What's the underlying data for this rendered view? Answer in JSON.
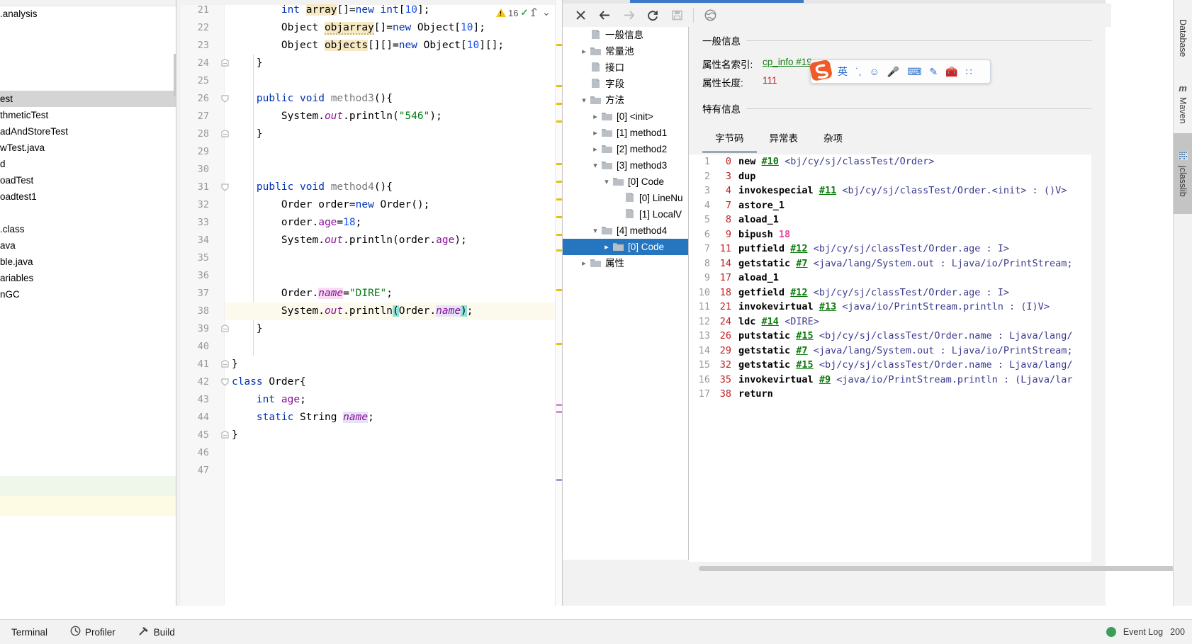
{
  "project_tree": {
    "name": "project-file-tree",
    "items": [
      {
        "label": ".analysis",
        "selected": false
      },
      {
        "label": "",
        "selected": false
      },
      {
        "label": "",
        "selected": false
      },
      {
        "label": "",
        "selected": false
      },
      {
        "label": "",
        "selected": false
      },
      {
        "label": "est",
        "selected": true
      },
      {
        "label": "thmeticTest",
        "selected": false
      },
      {
        "label": "adAndStoreTest",
        "selected": false
      },
      {
        "label": "wTest.java",
        "selected": false
      },
      {
        "label": "d",
        "selected": false
      },
      {
        "label": "oadTest",
        "selected": false
      },
      {
        "label": "oadtest1",
        "selected": false
      },
      {
        "label": "",
        "selected": false
      },
      {
        "label": ".class",
        "selected": false
      },
      {
        "label": "ava",
        "selected": false
      },
      {
        "label": "ble.java",
        "selected": false
      },
      {
        "label": "ariables",
        "selected": false
      },
      {
        "label": "nGC",
        "selected": false
      }
    ]
  },
  "editor": {
    "name": "code-editor",
    "current_line": 38,
    "inspection": {
      "warning_count": "16",
      "check_count": "1",
      "up_label": "⌃",
      "down_label": "⌄"
    },
    "lines": [
      {
        "n": "21",
        "html": "        <span class='kw'>int</span> <span class='hl-ident'>array</span>[]=<span class='kw'>new</span> <span class='kw'>int</span>[<span class='num'>10</span>];"
      },
      {
        "n": "22",
        "html": "        Object <span class='hl-ident squiggle'>objarray</span>[]=<span class='kw'>new</span> Object[<span class='num'>10</span>];"
      },
      {
        "n": "23",
        "html": "        Object <span class='hl-ident'>objects</span>[][]=<span class='kw'>new</span> Object[<span class='num'>10</span>][];"
      },
      {
        "n": "24",
        "html": "    }"
      },
      {
        "n": "25",
        "html": ""
      },
      {
        "n": "26",
        "html": "    <span class='kw'>public</span> <span class='kw'>void</span> <span class='mname'>method3</span>(){"
      },
      {
        "n": "27",
        "html": "        System.<span class='fld-i'>out</span>.println(<span class='str'>\"546\"</span>);"
      },
      {
        "n": "28",
        "html": "    }"
      },
      {
        "n": "29",
        "html": ""
      },
      {
        "n": "30",
        "html": ""
      },
      {
        "n": "31",
        "html": "    <span class='kw'>public</span> <span class='kw'>void</span> <span class='mname'>method4</span>(){"
      },
      {
        "n": "32",
        "html": "        Order order=<span class='kw'>new</span> Order();"
      },
      {
        "n": "33",
        "html": "        order.<span class='fld'>age</span>=<span class='num'>18</span>;"
      },
      {
        "n": "34",
        "html": "        System.<span class='fld-i'>out</span>.println(order.<span class='fld'>age</span>);"
      },
      {
        "n": "35",
        "html": ""
      },
      {
        "n": "36",
        "html": ""
      },
      {
        "n": "37",
        "html": "        Order.<span class='fld-i hl-pink'>name</span>=<span class='str'>\"DIRE\"</span>;"
      },
      {
        "n": "38",
        "html": "        System.<span class='fld-i'>out</span>.println<span class='hl-teal'>(</span>Order.<span class='fld-i hl-lav'>name</span><span class='hl-teal'>)</span>;"
      },
      {
        "n": "39",
        "html": "    }"
      },
      {
        "n": "40",
        "html": ""
      },
      {
        "n": "41",
        "html": "}"
      },
      {
        "n": "42",
        "html": "<span class='kw'>class</span> Order{"
      },
      {
        "n": "43",
        "html": "    <span class='kw'>int</span> <span class='fld'>age</span>;"
      },
      {
        "n": "44",
        "html": "    <span class='kw'>static</span> String <span class='fld-i hl-lav'>name</span>;"
      },
      {
        "n": "45",
        "html": "}"
      },
      {
        "n": "46",
        "html": ""
      },
      {
        "n": "47",
        "html": ""
      }
    ]
  },
  "jclasslib": {
    "toolbar": [
      {
        "name": "close-icon",
        "title": "✕",
        "enabled": true
      },
      {
        "name": "back-arrow-icon",
        "title": "←",
        "enabled": true
      },
      {
        "name": "forward-arrow-icon",
        "title": "→",
        "enabled": false
      },
      {
        "name": "refresh-icon",
        "title": "↻",
        "enabled": true
      },
      {
        "name": "save-icon",
        "title": "Ὃe",
        "enabled": false
      },
      {
        "name": "globe-icon",
        "title": "ἱ0",
        "enabled": true
      }
    ],
    "tree": [
      {
        "label": "一般信息",
        "indent": 1,
        "arrow": "",
        "icon": "file",
        "selected": false
      },
      {
        "label": "常量池",
        "indent": 1,
        "arrow": "collapsed",
        "icon": "folder",
        "selected": false
      },
      {
        "label": "接口",
        "indent": 1,
        "arrow": "",
        "icon": "file",
        "selected": false
      },
      {
        "label": "字段",
        "indent": 1,
        "arrow": "",
        "icon": "file",
        "selected": false
      },
      {
        "label": "方法",
        "indent": 1,
        "arrow": "expanded",
        "icon": "folder",
        "selected": false
      },
      {
        "label": "[0] <init>",
        "indent": 2,
        "arrow": "collapsed",
        "icon": "folder",
        "selected": false
      },
      {
        "label": "[1] method1",
        "indent": 2,
        "arrow": "collapsed",
        "icon": "folder",
        "selected": false
      },
      {
        "label": "[2] method2",
        "indent": 2,
        "arrow": "collapsed",
        "icon": "folder",
        "selected": false
      },
      {
        "label": "[3] method3",
        "indent": 2,
        "arrow": "expanded",
        "icon": "folder",
        "selected": false
      },
      {
        "label": "[0] Code",
        "indent": 3,
        "arrow": "expanded",
        "icon": "folder",
        "selected": false
      },
      {
        "label": "[0] LineNu",
        "indent": 4,
        "arrow": "",
        "icon": "file",
        "selected": false
      },
      {
        "label": "[1] LocalV",
        "indent": 4,
        "arrow": "",
        "icon": "file",
        "selected": false
      },
      {
        "label": "[4] method4",
        "indent": 2,
        "arrow": "expanded",
        "icon": "folder",
        "selected": false
      },
      {
        "label": "[0] Code",
        "indent": 3,
        "arrow": "collapsed",
        "icon": "folder",
        "selected": true
      },
      {
        "label": "属性",
        "indent": 1,
        "arrow": "collapsed",
        "icon": "folder",
        "selected": false
      }
    ],
    "detail": {
      "general_header": "一般信息",
      "attr_name_label": "属性名索引:",
      "attr_name_value": "cp_info #19",
      "attr_len_label": "属性长度:",
      "attr_len_value": "111",
      "specific_header": "特有信息",
      "tabs": [
        {
          "label": "字节码",
          "active": true
        },
        {
          "label": "异常表",
          "active": false
        },
        {
          "label": "杂项",
          "active": false
        }
      ]
    },
    "bytecode": [
      {
        "i": "1",
        "off": "0",
        "op": "new",
        "cp": "#10",
        "arg": "",
        "desc": "<bj/cy/sj/classTest/Order>"
      },
      {
        "i": "2",
        "off": "3",
        "op": "dup",
        "cp": "",
        "arg": "",
        "desc": ""
      },
      {
        "i": "3",
        "off": "4",
        "op": "invokespecial",
        "cp": "#11",
        "arg": "",
        "desc": "<bj/cy/sj/classTest/Order.<init> : ()V>"
      },
      {
        "i": "4",
        "off": "7",
        "op": "astore_1",
        "cp": "",
        "arg": "",
        "desc": ""
      },
      {
        "i": "5",
        "off": "8",
        "op": "aload_1",
        "cp": "",
        "arg": "",
        "desc": ""
      },
      {
        "i": "6",
        "off": "9",
        "op": "bipush",
        "cp": "",
        "arg": "18",
        "desc": ""
      },
      {
        "i": "7",
        "off": "11",
        "op": "putfield",
        "cp": "#12",
        "arg": "",
        "desc": "<bj/cy/sj/classTest/Order.age : I>"
      },
      {
        "i": "8",
        "off": "14",
        "op": "getstatic",
        "cp": "#7",
        "arg": "",
        "desc": "<java/lang/System.out : Ljava/io/PrintStream;"
      },
      {
        "i": "9",
        "off": "17",
        "op": "aload_1",
        "cp": "",
        "arg": "",
        "desc": ""
      },
      {
        "i": "10",
        "off": "18",
        "op": "getfield",
        "cp": "#12",
        "arg": "",
        "desc": "<bj/cy/sj/classTest/Order.age : I>"
      },
      {
        "i": "11",
        "off": "21",
        "op": "invokevirtual",
        "cp": "#13",
        "arg": "",
        "desc": "<java/io/PrintStream.println : (I)V>"
      },
      {
        "i": "12",
        "off": "24",
        "op": "ldc",
        "cp": "#14",
        "arg": "",
        "desc": "<DIRE>"
      },
      {
        "i": "13",
        "off": "26",
        "op": "putstatic",
        "cp": "#15",
        "arg": "",
        "desc": "<bj/cy/sj/classTest/Order.name : Ljava/lang/"
      },
      {
        "i": "14",
        "off": "29",
        "op": "getstatic",
        "cp": "#7",
        "arg": "",
        "desc": "<java/lang/System.out : Ljava/io/PrintStream;"
      },
      {
        "i": "15",
        "off": "32",
        "op": "getstatic",
        "cp": "#15",
        "arg": "",
        "desc": "<bj/cy/sj/classTest/Order.name : Ljava/lang/"
      },
      {
        "i": "16",
        "off": "35",
        "op": "invokevirtual",
        "cp": "#9",
        "arg": "",
        "desc": "<java/io/PrintStream.println : (Ljava/lar"
      },
      {
        "i": "17",
        "off": "38",
        "op": "return",
        "cp": "",
        "arg": "",
        "desc": ""
      }
    ]
  },
  "right_rail": {
    "tabs": [
      {
        "label": "Database",
        "icon": "",
        "active": false
      },
      {
        "label": "Maven",
        "icon": "m",
        "active": false
      },
      {
        "label": "jclasslib",
        "icon": "grid",
        "active": true
      }
    ]
  },
  "ime": {
    "items": [
      {
        "name": "language-mode",
        "label": "英"
      },
      {
        "name": "punctuation-toggle",
        "label": "˙,"
      },
      {
        "name": "emoji-icon",
        "label": "☺"
      },
      {
        "name": "voice-input-icon",
        "label": "🎤"
      },
      {
        "name": "keyboard-icon",
        "label": "⌨"
      },
      {
        "name": "handwriting-icon",
        "label": "✎"
      },
      {
        "name": "toolbox-icon",
        "label": "🧰"
      },
      {
        "name": "menu-grid-icon",
        "label": "∷"
      }
    ]
  },
  "statusbar": {
    "items": [
      {
        "name": "terminal-button",
        "label": "Terminal",
        "icon": ""
      },
      {
        "name": "profiler-button",
        "label": "Profiler",
        "icon": "clock"
      },
      {
        "name": "build-button",
        "label": "Build",
        "icon": "hammer"
      }
    ],
    "event_log": "Event Log",
    "zoom": "200"
  },
  "colors": {
    "accent_blue": "#2675bf",
    "tab_blue": "#3c79c8",
    "keyword": "#0033b3",
    "string": "#067d17",
    "field": "#871094",
    "cp_green": "#0a7a0a",
    "offset_red": "#c02020"
  }
}
